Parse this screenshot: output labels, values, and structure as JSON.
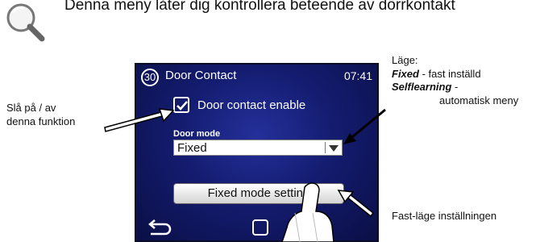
{
  "banner": {
    "text": "Denna meny låter dig kontrollera beteende av dörrkontakt"
  },
  "device": {
    "screen_number": "30",
    "title": "Door Contact",
    "clock": "07:41",
    "checkbox": {
      "label": "Door contact enable",
      "checked": true
    },
    "mode": {
      "label": "Door mode",
      "value": "Fixed"
    },
    "fixed_button": {
      "label": "Fixed mode setting"
    }
  },
  "annotations": {
    "left_line1": "Slå på / av",
    "left_line2": "denna funktion",
    "right_mode_heading": "Läge:",
    "right_fixed_term": "Fixed",
    "right_fixed_desc": " - fast inställd",
    "right_self_term": "Selflearning",
    "right_self_desc": " -",
    "right_auto": "automatisk meny",
    "right_bottom": "Fast-läge inställningen"
  },
  "colors": {
    "screen_dark": "#0a0f45",
    "screen_mid": "#24309a"
  }
}
